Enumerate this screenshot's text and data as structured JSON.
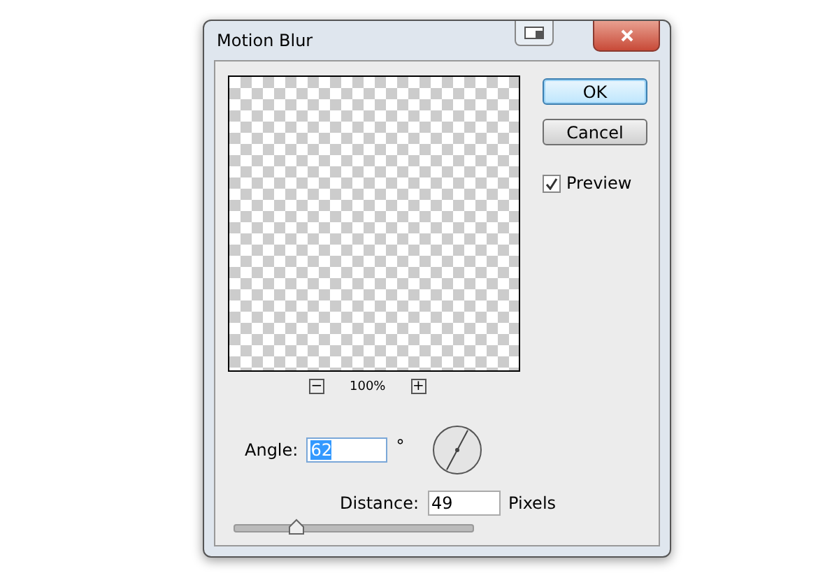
{
  "window": {
    "title": "Motion Blur"
  },
  "buttons": [
    {
      "label": "OK",
      "default": true
    },
    {
      "label": "Cancel",
      "default": false
    }
  ],
  "preview": {
    "label": "Preview",
    "checked": true
  },
  "zoom": {
    "minus": "−",
    "value": "100%",
    "plus": "+"
  },
  "angle": {
    "label": "Angle:",
    "value": "62",
    "unit": "°"
  },
  "distance": {
    "label": "Distance:",
    "value": "49",
    "unit": "Pixels"
  },
  "slider": {
    "level": 0.26
  }
}
